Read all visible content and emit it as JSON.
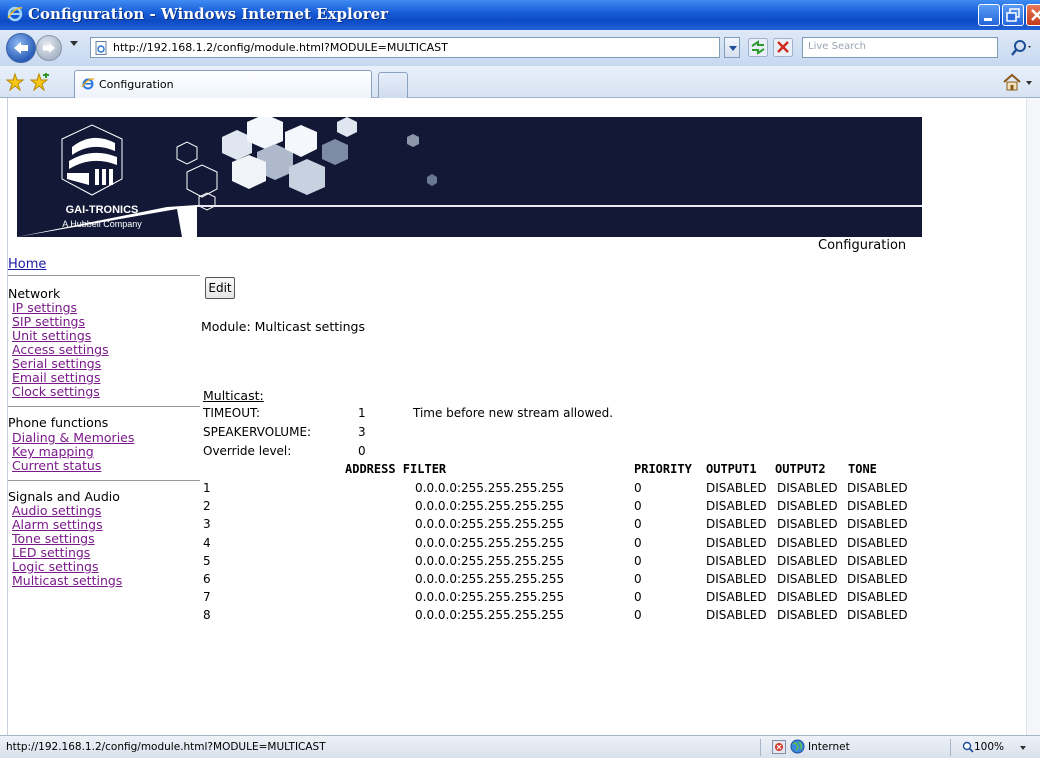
{
  "window": {
    "title": "Configuration - Windows Internet Explorer"
  },
  "addressbar": {
    "url": "http://192.168.1.2/config/module.html?MODULE=MULTICAST",
    "search_placeholder": "Live Search"
  },
  "tabs": [
    {
      "label": "Configuration"
    }
  ],
  "banner": {
    "company": "GAI-TRONICS",
    "tagline": "A Hubbell Company"
  },
  "page": {
    "heading": "Configuration",
    "home_link": "Home",
    "edit_label": "Edit",
    "module_title": "Module: Multicast settings"
  },
  "sidebar": {
    "groups": [
      {
        "title": "Network",
        "links": [
          "IP settings",
          "SIP settings",
          "Unit settings",
          "Access settings",
          "Serial settings",
          "Email settings",
          "Clock settings"
        ]
      },
      {
        "title": "Phone functions",
        "links": [
          "Dialing & Memories",
          "Key mapping",
          "Current status"
        ]
      },
      {
        "title": "Signals and Audio",
        "links": [
          "Audio settings",
          "Alarm settings",
          "Tone settings",
          "LED settings",
          "Logic settings",
          "Multicast settings"
        ]
      }
    ]
  },
  "multicast": {
    "heading": "Multicast:",
    "settings": [
      {
        "key": "TIMEOUT:",
        "value": "1",
        "note": "Time before new stream allowed."
      },
      {
        "key": "SPEAKERVOLUME:",
        "value": "3",
        "note": ""
      },
      {
        "key": "Override level:",
        "value": "0",
        "note": ""
      }
    ],
    "columns": [
      "ADDRESS FILTER",
      "PRIORITY",
      "OUTPUT1",
      "OUTPUT2",
      "TONE"
    ],
    "rows": [
      {
        "n": "1",
        "filter": "0.0.0.0:255.255.255.255",
        "priority": "0",
        "out1": "DISABLED",
        "out2": "DISABLED",
        "tone": "DISABLED"
      },
      {
        "n": "2",
        "filter": "0.0.0.0:255.255.255.255",
        "priority": "0",
        "out1": "DISABLED",
        "out2": "DISABLED",
        "tone": "DISABLED"
      },
      {
        "n": "3",
        "filter": "0.0.0.0:255.255.255.255",
        "priority": "0",
        "out1": "DISABLED",
        "out2": "DISABLED",
        "tone": "DISABLED"
      },
      {
        "n": "4",
        "filter": "0.0.0.0:255.255.255.255",
        "priority": "0",
        "out1": "DISABLED",
        "out2": "DISABLED",
        "tone": "DISABLED"
      },
      {
        "n": "5",
        "filter": "0.0.0.0:255.255.255.255",
        "priority": "0",
        "out1": "DISABLED",
        "out2": "DISABLED",
        "tone": "DISABLED"
      },
      {
        "n": "6",
        "filter": "0.0.0.0:255.255.255.255",
        "priority": "0",
        "out1": "DISABLED",
        "out2": "DISABLED",
        "tone": "DISABLED"
      },
      {
        "n": "7",
        "filter": "0.0.0.0:255.255.255.255",
        "priority": "0",
        "out1": "DISABLED",
        "out2": "DISABLED",
        "tone": "DISABLED"
      },
      {
        "n": "8",
        "filter": "0.0.0.0:255.255.255.255",
        "priority": "0",
        "out1": "DISABLED",
        "out2": "DISABLED",
        "tone": "DISABLED"
      }
    ]
  },
  "statusbar": {
    "url": "http://192.168.1.2/config/module.html?MODULE=MULTICAST",
    "zone": "Internet",
    "zoom": "100%"
  },
  "colors": {
    "titlebar": "#1a5fd8",
    "banner_bg": "#121836",
    "visited_link": "#7a1a8a",
    "link": "#1a1aa6"
  }
}
